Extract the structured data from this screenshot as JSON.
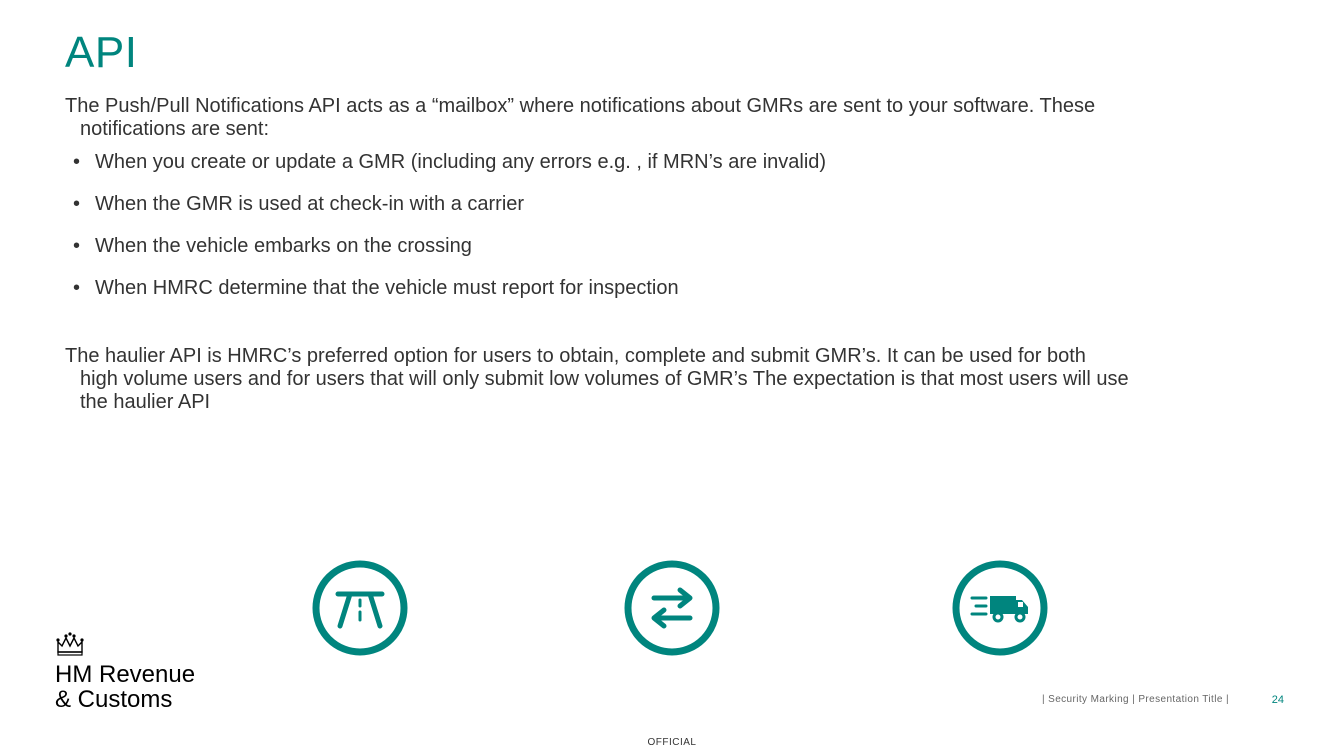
{
  "title": "API",
  "intro_line1": "The Push/Pull Notifications API acts as a “mailbox” where notifications about GMRs are sent to your software. These",
  "intro_line2": "notifications are sent:",
  "bullets": [
    "When you create or update a GMR (including any errors e.g. , if MRN’s are invalid)",
    "When the GMR is used at check-in with a carrier",
    "When the vehicle embarks on the crossing",
    "When HMRC determine that the vehicle must report for inspection"
  ],
  "closing_line1": "The haulier API is HMRC’s preferred option for users to obtain, complete and submit GMR’s. It can be used for both",
  "closing_line2": "high volume users and for users that will only submit low volumes of GMR’s The expectation is that most users will use",
  "closing_line3": "the haulier API",
  "logo": {
    "line1": "HM Revenue",
    "line2": "& Customs"
  },
  "footer": {
    "meta": "|  Security Marking  |   Presentation Title  |",
    "page": "24",
    "official": "OFFICIAL"
  },
  "colors": {
    "accent": "#00857e"
  }
}
